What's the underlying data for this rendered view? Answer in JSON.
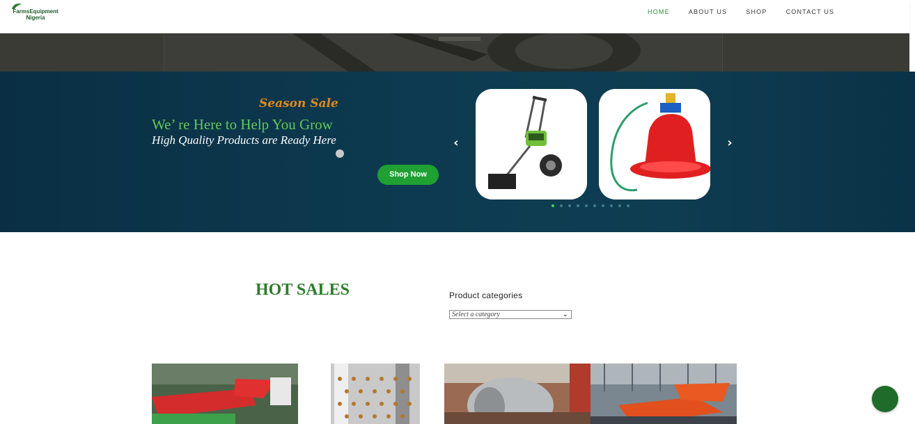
{
  "brand": {
    "logo_text": "FarmsEquipment Nigeria"
  },
  "nav": {
    "items": [
      {
        "label": "HOME",
        "active": true
      },
      {
        "label": "ABOUT US",
        "active": false
      },
      {
        "label": "SHOP",
        "active": false
      },
      {
        "label": "CONTACT US",
        "active": false
      }
    ]
  },
  "hero": {
    "tag": "Season Sale",
    "headline": "We’ re Here to Help You Grow",
    "sub": "High Quality Products are Ready Here",
    "shop_button": "Shop Now",
    "prev_icon": "‹",
    "next_icon": "›",
    "slides_count": 10,
    "active_slide": 1,
    "cards": [
      {
        "icon": "walk-behind-tiller-image"
      },
      {
        "icon": "poultry-drinker-image"
      }
    ]
  },
  "section": {
    "title": "HOT SALES",
    "categories_label": "Product categories",
    "categories_select": "Select a category"
  },
  "products": [
    {
      "icon": "red-machine-image"
    },
    {
      "icon": "steel-drum-image"
    },
    {
      "icon": "roller-drum-image"
    },
    {
      "icon": "orange-machine-image"
    }
  ],
  "colors": {
    "accent_green": "#2e8b3a",
    "hero_bg": "#0d3a50",
    "tag_orange": "#e08a1e",
    "button_green": "#1fa032"
  }
}
